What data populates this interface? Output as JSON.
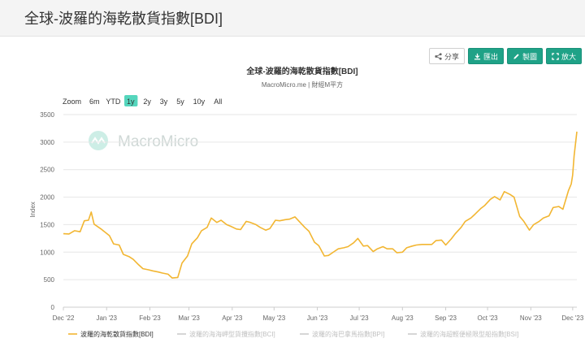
{
  "page": {
    "title": "全球-波羅的海乾散貨指數[BDI]"
  },
  "toolbar": {
    "share": "分享",
    "export": "匯出",
    "draw": "製圖",
    "expand": "放大"
  },
  "zoom": {
    "label": "Zoom",
    "options": [
      "6m",
      "YTD",
      "1y",
      "2y",
      "3y",
      "5y",
      "10y",
      "All"
    ],
    "selected": "1y"
  },
  "watermark": "MacroMicro",
  "colors": {
    "line": "#f2b632",
    "accent": "#1fa287",
    "selected_zoom": "#55d6bd"
  },
  "chart_data": {
    "type": "line",
    "title": "全球-波羅的海乾散貨指數[BDI]",
    "subtitle": "MacroMicro.me | 財經M平方",
    "ylabel": "Index",
    "xlabel": "",
    "ylim": [
      0,
      3500
    ],
    "yticks": [
      0,
      500,
      1000,
      1500,
      2000,
      2500,
      3000,
      3500
    ],
    "xticks": [
      "Dec '22",
      "Jan '23",
      "Feb '23",
      "Mar '23",
      "Apr '23",
      "May '23",
      "Jun '23",
      "Jul '23",
      "Aug '23",
      "Sep '23",
      "Oct '23",
      "Nov '23",
      "Dec '23"
    ],
    "grid": true,
    "legend_position": "bottom",
    "series": [
      {
        "name": "波羅的海乾散貨指數[BDI]",
        "visible": true,
        "points": [
          [
            "2022-12-01",
            1335
          ],
          [
            "2022-12-05",
            1330
          ],
          [
            "2022-12-09",
            1390
          ],
          [
            "2022-12-13",
            1370
          ],
          [
            "2022-12-16",
            1570
          ],
          [
            "2022-12-19",
            1580
          ],
          [
            "2022-12-21",
            1730
          ],
          [
            "2022-12-23",
            1510
          ],
          [
            "2022-12-28",
            1420
          ],
          [
            "2023-01-03",
            1300
          ],
          [
            "2023-01-06",
            1150
          ],
          [
            "2023-01-10",
            1130
          ],
          [
            "2023-01-13",
            960
          ],
          [
            "2023-01-17",
            920
          ],
          [
            "2023-01-20",
            870
          ],
          [
            "2023-01-24",
            770
          ],
          [
            "2023-01-27",
            700
          ],
          [
            "2023-01-31",
            680
          ],
          [
            "2023-02-03",
            660
          ],
          [
            "2023-02-07",
            640
          ],
          [
            "2023-02-10",
            620
          ],
          [
            "2023-02-14",
            600
          ],
          [
            "2023-02-17",
            530
          ],
          [
            "2023-02-21",
            540
          ],
          [
            "2023-02-24",
            800
          ],
          [
            "2023-02-28",
            930
          ],
          [
            "2023-03-03",
            1150
          ],
          [
            "2023-03-07",
            1260
          ],
          [
            "2023-03-10",
            1390
          ],
          [
            "2023-03-14",
            1450
          ],
          [
            "2023-03-17",
            1620
          ],
          [
            "2023-03-21",
            1540
          ],
          [
            "2023-03-24",
            1580
          ],
          [
            "2023-03-28",
            1500
          ],
          [
            "2023-03-31",
            1470
          ],
          [
            "2023-04-04",
            1420
          ],
          [
            "2023-04-07",
            1410
          ],
          [
            "2023-04-11",
            1560
          ],
          [
            "2023-04-14",
            1540
          ],
          [
            "2023-04-18",
            1500
          ],
          [
            "2023-04-21",
            1450
          ],
          [
            "2023-04-25",
            1400
          ],
          [
            "2023-04-28",
            1430
          ],
          [
            "2023-05-02",
            1580
          ],
          [
            "2023-05-05",
            1570
          ],
          [
            "2023-05-09",
            1590
          ],
          [
            "2023-05-12",
            1600
          ],
          [
            "2023-05-16",
            1640
          ],
          [
            "2023-05-19",
            1560
          ],
          [
            "2023-05-23",
            1450
          ],
          [
            "2023-05-26",
            1380
          ],
          [
            "2023-05-30",
            1180
          ],
          [
            "2023-06-02",
            1120
          ],
          [
            "2023-06-06",
            930
          ],
          [
            "2023-06-09",
            940
          ],
          [
            "2023-06-13",
            1010
          ],
          [
            "2023-06-16",
            1060
          ],
          [
            "2023-06-20",
            1080
          ],
          [
            "2023-06-23",
            1100
          ],
          [
            "2023-06-27",
            1170
          ],
          [
            "2023-06-30",
            1250
          ],
          [
            "2023-07-04",
            1110
          ],
          [
            "2023-07-07",
            1120
          ],
          [
            "2023-07-11",
            1010
          ],
          [
            "2023-07-14",
            1060
          ],
          [
            "2023-07-18",
            1100
          ],
          [
            "2023-07-21",
            1060
          ],
          [
            "2023-07-25",
            1060
          ],
          [
            "2023-07-28",
            990
          ],
          [
            "2023-08-01",
            1000
          ],
          [
            "2023-08-04",
            1080
          ],
          [
            "2023-08-08",
            1110
          ],
          [
            "2023-08-11",
            1130
          ],
          [
            "2023-08-15",
            1140
          ],
          [
            "2023-08-18",
            1140
          ],
          [
            "2023-08-22",
            1140
          ],
          [
            "2023-08-25",
            1210
          ],
          [
            "2023-08-29",
            1220
          ],
          [
            "2023-09-01",
            1130
          ],
          [
            "2023-09-05",
            1240
          ],
          [
            "2023-09-08",
            1340
          ],
          [
            "2023-09-12",
            1450
          ],
          [
            "2023-09-15",
            1560
          ],
          [
            "2023-09-19",
            1620
          ],
          [
            "2023-09-22",
            1690
          ],
          [
            "2023-09-26",
            1790
          ],
          [
            "2023-09-29",
            1850
          ],
          [
            "2023-10-03",
            1960
          ],
          [
            "2023-10-06",
            2010
          ],
          [
            "2023-10-10",
            1950
          ],
          [
            "2023-10-13",
            2100
          ],
          [
            "2023-10-17",
            2050
          ],
          [
            "2023-10-20",
            2000
          ],
          [
            "2023-10-24",
            1650
          ],
          [
            "2023-10-27",
            1560
          ],
          [
            "2023-10-31",
            1400
          ],
          [
            "2023-11-03",
            1500
          ],
          [
            "2023-11-07",
            1560
          ],
          [
            "2023-11-10",
            1620
          ],
          [
            "2023-11-14",
            1660
          ],
          [
            "2023-11-17",
            1810
          ],
          [
            "2023-11-21",
            1830
          ],
          [
            "2023-11-24",
            1780
          ],
          [
            "2023-11-28",
            2120
          ],
          [
            "2023-11-30",
            2240
          ],
          [
            "2023-12-01",
            2400
          ],
          [
            "2023-12-02",
            2750
          ],
          [
            "2023-12-04",
            3190
          ]
        ]
      },
      {
        "name": "波羅的海海岬型貨攬指數[BCI]",
        "visible": false,
        "points": []
      },
      {
        "name": "波羅的海巴拿馬指數[BPI]",
        "visible": false,
        "points": []
      },
      {
        "name": "波羅的海超輕便極限型船指數[BSI]",
        "visible": false,
        "points": []
      }
    ]
  }
}
